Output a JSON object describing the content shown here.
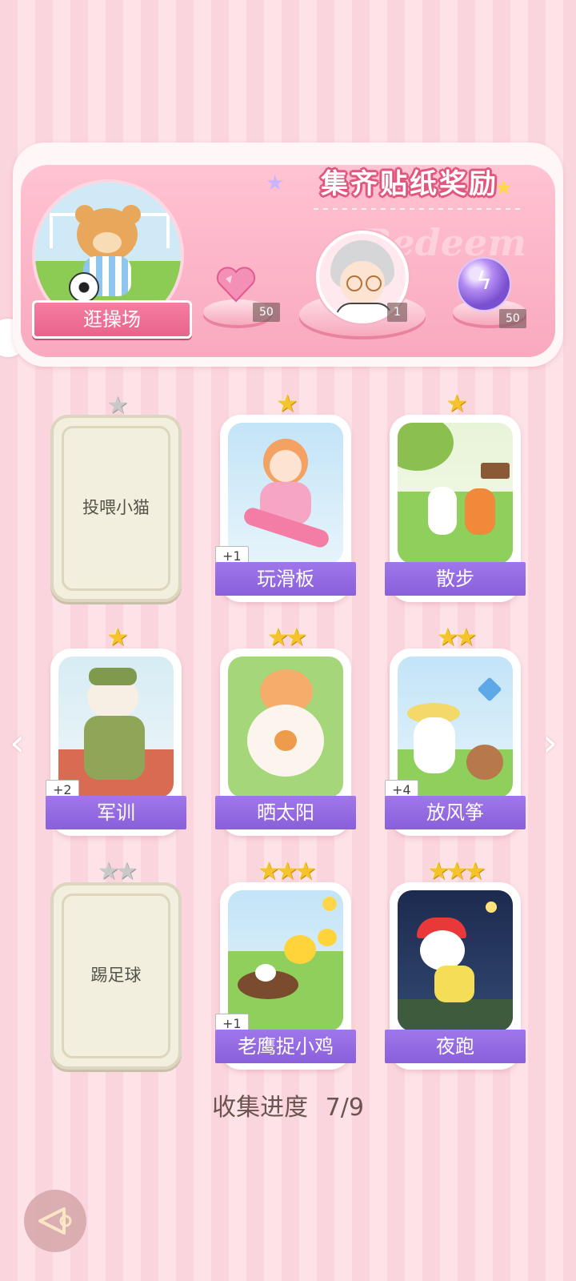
{
  "banner": {
    "title": "集齐贴纸奖励",
    "watermark": "Redeem",
    "scene_label": "逛操场",
    "rewards": [
      {
        "icon": "pink-heart-gem-icon",
        "qty": "50"
      },
      {
        "icon": "character-avatar-icon",
        "qty": "1"
      },
      {
        "icon": "purple-energy-orb-icon",
        "qty": "50"
      }
    ]
  },
  "cards": [
    {
      "label": "投喂小猫",
      "stars": 1,
      "locked": true,
      "plus": ""
    },
    {
      "label": "玩滑板",
      "stars": 1,
      "locked": false,
      "plus": "+1"
    },
    {
      "label": "散步",
      "stars": 1,
      "locked": false,
      "plus": ""
    },
    {
      "label": "军训",
      "stars": 1,
      "locked": false,
      "plus": "+2"
    },
    {
      "label": "晒太阳",
      "stars": 2,
      "locked": false,
      "plus": ""
    },
    {
      "label": "放风筝",
      "stars": 2,
      "locked": false,
      "plus": "+4"
    },
    {
      "label": "踢足球",
      "stars": 2,
      "locked": true,
      "plus": ""
    },
    {
      "label": "老鹰捉小鸡",
      "stars": 3,
      "locked": false,
      "plus": "+1"
    },
    {
      "label": "夜跑",
      "stars": 3,
      "locked": false,
      "plus": ""
    }
  ],
  "progress": {
    "label": "收集进度",
    "value": "7/9"
  },
  "colors": {
    "accent_purple": "#8a5fdb",
    "accent_pink": "#e9638b",
    "star_gold": "#f5c32c"
  }
}
